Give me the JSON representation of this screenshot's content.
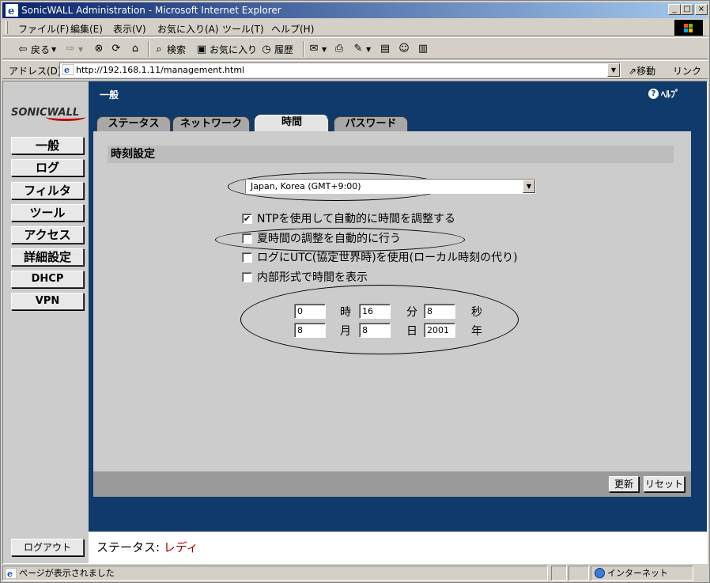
{
  "window": {
    "title": "SonicWALL Administration - Microsoft Internet Explorer",
    "min": "_",
    "max": "□",
    "close": "×"
  },
  "menu": [
    "ファイル(F)",
    "編集(E)",
    "表示(V)",
    "お気に入り(A)",
    "ツール(T)",
    "ヘルプ(H)"
  ],
  "toolbar": {
    "back": "戻る",
    "search": "検索",
    "favorites": "お気に入り",
    "history": "履歴"
  },
  "address": {
    "label": "アドレス(D)",
    "url": "http://192.168.1.11/management.html",
    "go": "移動",
    "links": "リンク »"
  },
  "app": {
    "logo": "SONICWALL",
    "heading": "一般",
    "help": "ﾍﾙﾌﾟ",
    "nav": [
      "一般",
      "ログ",
      "フィルタ",
      "ツール",
      "アクセス",
      "詳細設定",
      "DHCP",
      "VPN"
    ],
    "logout": "ログアウト",
    "tabs": [
      "ステータス",
      "ネットワーク",
      "時間",
      "パスワード"
    ],
    "active_tab": "時間"
  },
  "panel": {
    "section_title": "時刻設定",
    "timezone": "Japan, Korea (GMT+9:00)",
    "options": [
      {
        "label": "NTPを使用して自動的に時間を調整する",
        "checked": true
      },
      {
        "label": "夏時間の調整を自動的に行う",
        "checked": false
      },
      {
        "label": "ログにUTC(協定世界時)を使用(ローカル時刻の代り)",
        "checked": false
      },
      {
        "label": "内部形式で時間を表示",
        "checked": false
      }
    ],
    "time": {
      "hour": "0",
      "hour_label": "時",
      "minute": "16",
      "minute_label": "分",
      "second": "8",
      "second_label": "秒",
      "month": "8",
      "month_label": "月",
      "day": "8",
      "day_label": "日",
      "year": "2001",
      "year_label": "年"
    },
    "update_button": "更新",
    "reset_button": "リセット"
  },
  "status": {
    "label": "ステータス:",
    "value": "レディ"
  },
  "iestatus": {
    "text": "ページが表示されました",
    "zone": "インターネット"
  },
  "colors": {
    "title_bar": "#0a246a",
    "main_bg": "#0f3a6b",
    "status_value": "#a00000"
  }
}
